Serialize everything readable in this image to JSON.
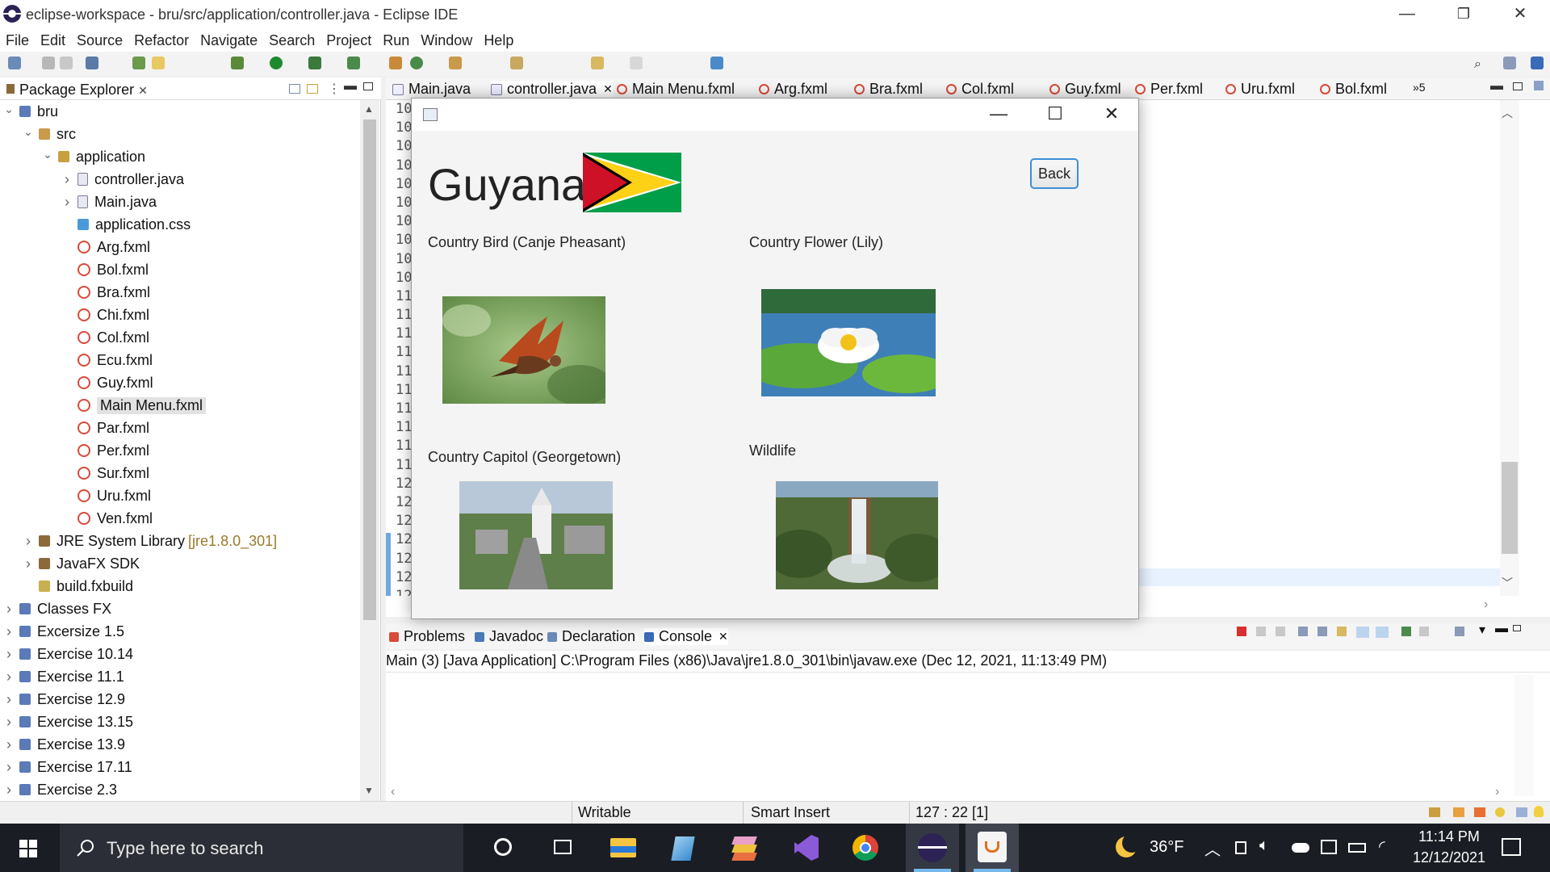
{
  "window": {
    "title": "eclipse-workspace - bru/src/application/controller.java - Eclipse IDE",
    "minimize": "—",
    "restore": "❐",
    "close": "✕"
  },
  "menu": [
    "File",
    "Edit",
    "Source",
    "Refactor",
    "Navigate",
    "Search",
    "Project",
    "Run",
    "Window",
    "Help"
  ],
  "package_explorer": {
    "title": "Package Explorer",
    "tree": [
      {
        "label": "bru",
        "depth": 0,
        "arrow": "open",
        "icon": "project-icon"
      },
      {
        "label": "src",
        "depth": 1,
        "arrow": "open",
        "icon": "source-folder-icon"
      },
      {
        "label": "application",
        "depth": 2,
        "arrow": "open",
        "icon": "package-icon"
      },
      {
        "label": "controller.java",
        "depth": 3,
        "arrow": "closed",
        "icon": "java-file-icon"
      },
      {
        "label": "Main.java",
        "depth": 3,
        "arrow": "closed",
        "icon": "java-file-icon"
      },
      {
        "label": "application.css",
        "depth": 3,
        "arrow": "none",
        "icon": "css-file-icon"
      },
      {
        "label": "Arg.fxml",
        "depth": 3,
        "arrow": "none",
        "icon": "fxml-file-icon"
      },
      {
        "label": "Bol.fxml",
        "depth": 3,
        "arrow": "none",
        "icon": "fxml-file-icon"
      },
      {
        "label": "Bra.fxml",
        "depth": 3,
        "arrow": "none",
        "icon": "fxml-file-icon"
      },
      {
        "label": "Chi.fxml",
        "depth": 3,
        "arrow": "none",
        "icon": "fxml-file-icon"
      },
      {
        "label": "Col.fxml",
        "depth": 3,
        "arrow": "none",
        "icon": "fxml-file-icon"
      },
      {
        "label": "Ecu.fxml",
        "depth": 3,
        "arrow": "none",
        "icon": "fxml-file-icon"
      },
      {
        "label": "Guy.fxml",
        "depth": 3,
        "arrow": "none",
        "icon": "fxml-file-icon"
      },
      {
        "label": "Main Menu.fxml",
        "depth": 3,
        "arrow": "none",
        "icon": "fxml-file-icon",
        "selected": true
      },
      {
        "label": "Par.fxml",
        "depth": 3,
        "arrow": "none",
        "icon": "fxml-file-icon"
      },
      {
        "label": "Per.fxml",
        "depth": 3,
        "arrow": "none",
        "icon": "fxml-file-icon"
      },
      {
        "label": "Sur.fxml",
        "depth": 3,
        "arrow": "none",
        "icon": "fxml-file-icon"
      },
      {
        "label": "Uru.fxml",
        "depth": 3,
        "arrow": "none",
        "icon": "fxml-file-icon"
      },
      {
        "label": "Ven.fxml",
        "depth": 3,
        "arrow": "none",
        "icon": "fxml-file-icon"
      },
      {
        "label": "JRE System Library",
        "depth": 1,
        "arrow": "closed",
        "icon": "library-icon",
        "decoration": "[jre1.8.0_301]"
      },
      {
        "label": "JavaFX SDK",
        "depth": 1,
        "arrow": "closed",
        "icon": "library-icon"
      },
      {
        "label": "build.fxbuild",
        "depth": 1,
        "arrow": "none",
        "icon": "build-file-icon"
      },
      {
        "label": "Classes FX",
        "depth": 0,
        "arrow": "closed",
        "icon": "project-icon"
      },
      {
        "label": "Excersize 1.5",
        "depth": 0,
        "arrow": "closed",
        "icon": "project-icon"
      },
      {
        "label": "Exercise 10.14",
        "depth": 0,
        "arrow": "closed",
        "icon": "project-icon"
      },
      {
        "label": "Exercise 11.1",
        "depth": 0,
        "arrow": "closed",
        "icon": "project-icon"
      },
      {
        "label": "Exercise 12.9",
        "depth": 0,
        "arrow": "closed",
        "icon": "project-icon"
      },
      {
        "label": "Exercise 13.15",
        "depth": 0,
        "arrow": "closed",
        "icon": "project-icon"
      },
      {
        "label": "Exercise 13.9",
        "depth": 0,
        "arrow": "closed",
        "icon": "project-icon"
      },
      {
        "label": "Exercise 17.11",
        "depth": 0,
        "arrow": "closed",
        "icon": "project-icon"
      },
      {
        "label": "Exercise 2.3",
        "depth": 0,
        "arrow": "closed",
        "icon": "project-icon"
      }
    ]
  },
  "editor_tabs": [
    {
      "label": "Main.java",
      "icon": "java-file-icon"
    },
    {
      "label": "controller.java",
      "icon": "java-file-icon",
      "active": true,
      "close": "✕"
    },
    {
      "label": "Main Menu.fxml",
      "icon": "fxml-file-icon"
    },
    {
      "label": "Arg.fxml",
      "icon": "fxml-file-icon"
    },
    {
      "label": "Bra.fxml",
      "icon": "fxml-file-icon"
    },
    {
      "label": "Col.fxml",
      "icon": "fxml-file-icon"
    },
    {
      "label": "Guy.fxml",
      "icon": "fxml-file-icon"
    },
    {
      "label": "Per.fxml",
      "icon": "fxml-file-icon"
    },
    {
      "label": "Uru.fxml",
      "icon": "fxml-file-icon"
    },
    {
      "label": "Bol.fxml",
      "icon": "fxml-file-icon"
    }
  ],
  "editor_overflow": "»5",
  "line_numbers": [
    "10",
    "10",
    "10",
    "10",
    "10",
    "10",
    "10",
    "10",
    "10",
    "10",
    "11",
    "11",
    "11",
    "11",
    "11",
    "11",
    "11",
    "11",
    "11",
    "11",
    "12",
    "12",
    "12",
    "12",
    "12",
    "12",
    "12",
    "12",
    "12"
  ],
  "console": {
    "tabs": [
      "Problems",
      "Javadoc",
      "Declaration",
      "Console"
    ],
    "tab_close": "✕",
    "status": "Main (3) [Java Application] C:\\Program Files (x86)\\Java\\jre1.8.0_301\\bin\\javaw.exe  (Dec 12, 2021, 11:13:49 PM)"
  },
  "statusbar": {
    "writable": "Writable",
    "insert_mode": "Smart Insert",
    "position": "127 : 22 [1]"
  },
  "fx_app": {
    "minimize": "—",
    "maximize": "☐",
    "close": "✕",
    "country": "Guyana",
    "back": "Back",
    "sections": {
      "bird": "Country Bird (Canje Pheasant)",
      "flower": "Country Flower (Lily)",
      "capital": "Country Capitol (Georgetown)",
      "wildlife": "Wildlife"
    },
    "colors": {
      "flag_green": "#009e49",
      "flag_yellow": "#fcd116",
      "flag_red": "#ce1126",
      "button_border": "#3c8fd8"
    }
  },
  "taskbar": {
    "search_placeholder": "Type here to search",
    "weather": "36°F",
    "time": "11:14 PM",
    "date": "12/12/2021",
    "pinned": [
      "cortana-icon",
      "task-view-icon",
      "file-explorer-icon",
      "notepad-icon",
      "layers-app-icon",
      "visual-studio-icon",
      "chrome-icon",
      "eclipse-icon",
      "java-icon"
    ]
  }
}
